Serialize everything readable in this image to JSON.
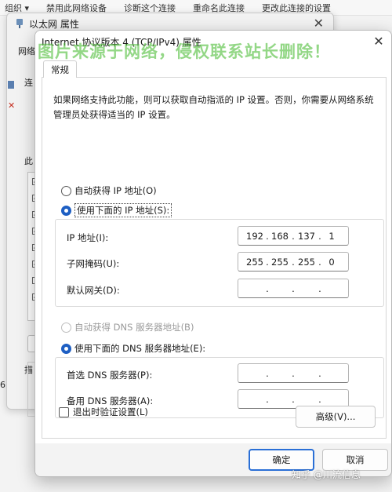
{
  "background": {
    "toolbar": {
      "items": [
        "组织 ▾",
        "禁用此网络设备",
        "诊断这个连接",
        "重命名此连接",
        "更改此连接的设置"
      ]
    },
    "eth_window": {
      "title": "以太网 属性",
      "tab_stub": "网络",
      "label_connect": "连",
      "label_this": "此",
      "label_desc": "描",
      "left_digit": "6"
    }
  },
  "dialog": {
    "title": "Internet 协议版本 4 (TCP/IPv4) 属性",
    "watermark": "图片来源于网络，侵权联系站长删除！",
    "tab": "常规",
    "description": "如果网络支持此功能，则可以获取自动指派的 IP 设置。否则，你需要从网络系统管理员处获得适当的 IP 设置。",
    "ip_section": {
      "auto_radio": "自动获得 IP 地址(O)",
      "manual_radio": "使用下面的 IP 地址(S):",
      "fields": [
        {
          "label": "IP 地址(I):",
          "value": [
            "192",
            "168",
            "137",
            "1"
          ]
        },
        {
          "label": "子网掩码(U):",
          "value": [
            "255",
            "255",
            "255",
            "0"
          ]
        },
        {
          "label": "默认网关(D):",
          "value": [
            "",
            "",
            "",
            ""
          ]
        }
      ]
    },
    "dns_section": {
      "auto_radio": "自动获得 DNS 服务器地址(B)",
      "manual_radio": "使用下面的 DNS 服务器地址(E):",
      "fields": [
        {
          "label": "首选 DNS 服务器(P):",
          "value": [
            "",
            "",
            "",
            ""
          ]
        },
        {
          "label": "备用 DNS 服务器(A):",
          "value": [
            "",
            "",
            "",
            ""
          ]
        }
      ]
    },
    "validate_checkbox": "退出时验证设置(L)",
    "advanced_button": "高级(V)...",
    "ok_button": "确定",
    "cancel_button": "取消"
  },
  "attribution": "知乎 @川流信息",
  "colors": {
    "accent": "#1e5fc3",
    "watermark": "#50be3c",
    "dialog_bg": "#ffffff",
    "footer_bg": "#f3f3f3"
  },
  "icons": {
    "eth_title_icon": "network-adapter-icon",
    "close": "close-icon"
  }
}
